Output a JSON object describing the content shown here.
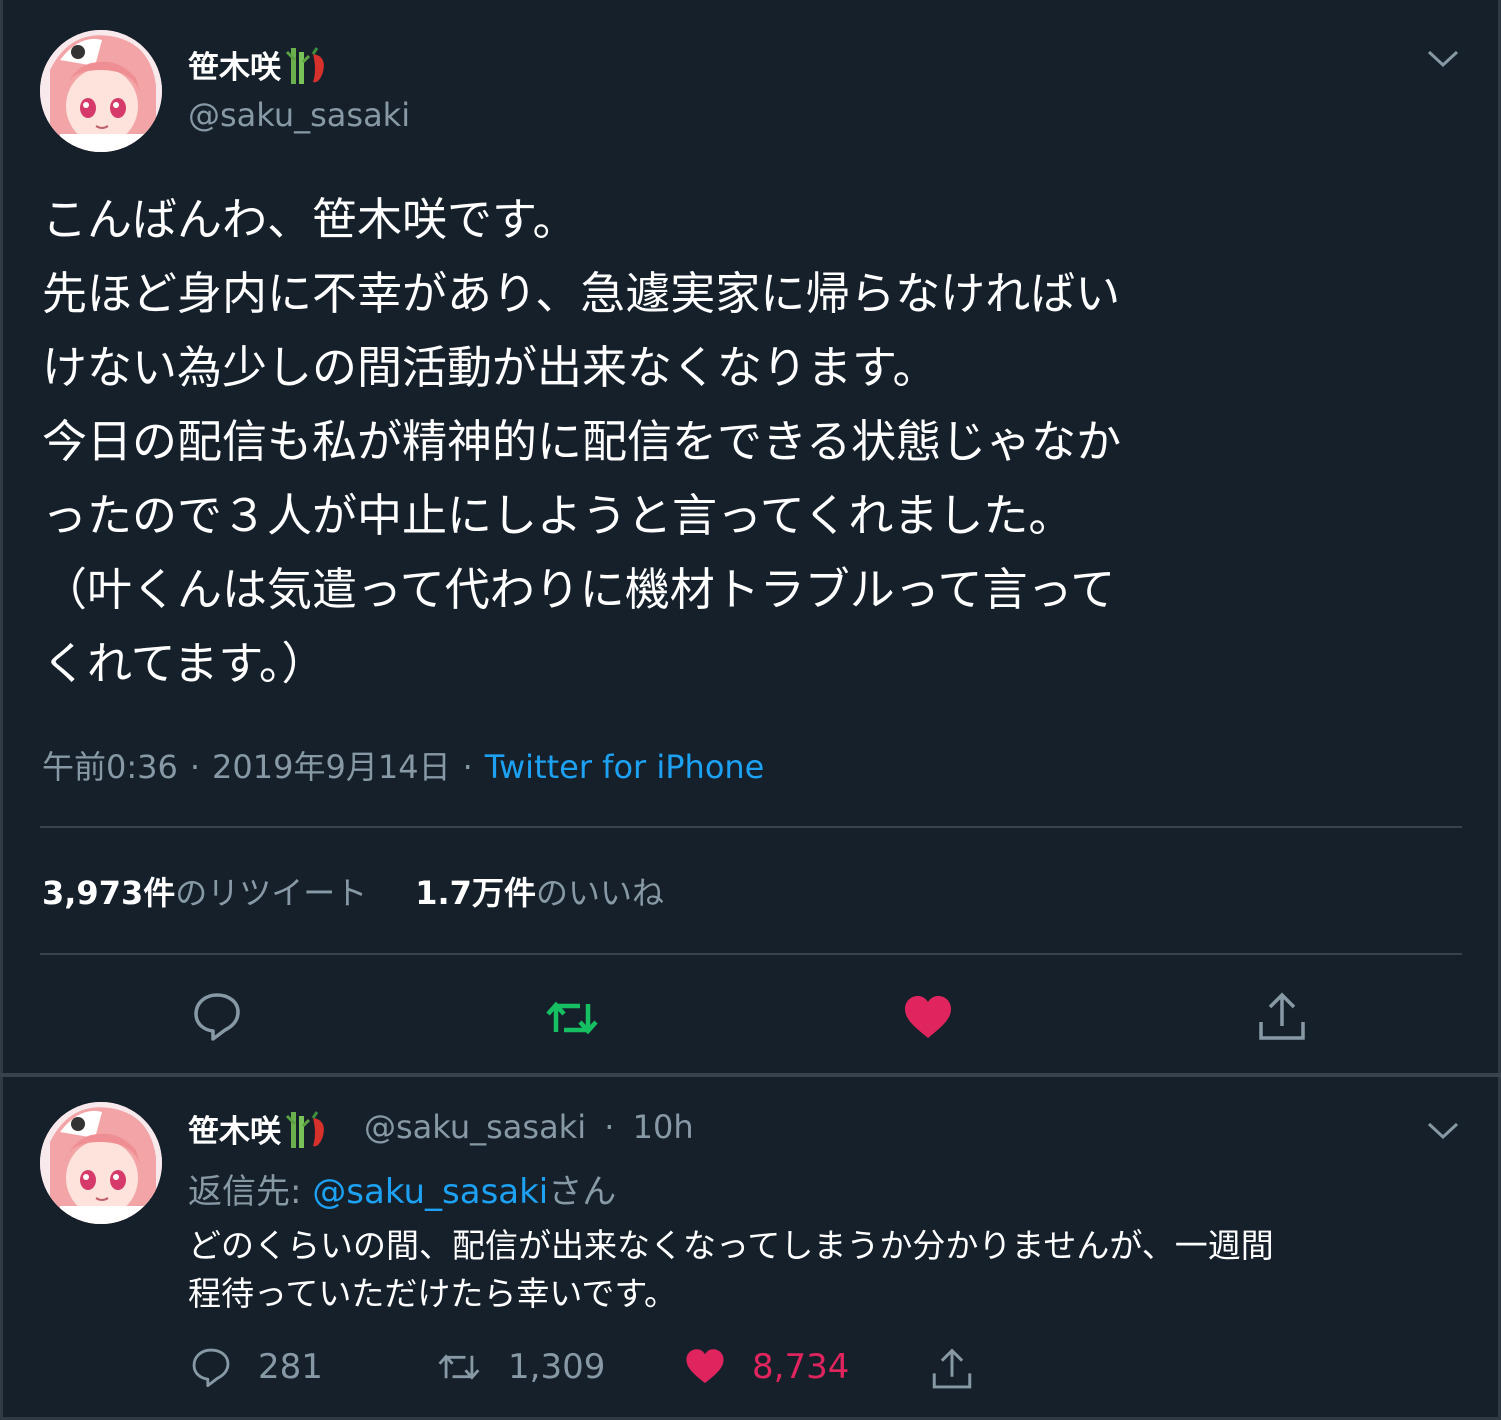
{
  "main_tweet": {
    "display_name": "笹木咲",
    "name_emoji": "bamboo-chili-emoji",
    "handle": "@saku_sasaki",
    "text_lines": [
      "こんばんわ、笹木咲です。",
      "先ほど身内に不幸があり、急遽実家に帰らなければい",
      "けない為少しの間活動が出来なくなります。",
      "今日の配信も私が精神的に配信をできる状態じゃなか",
      "ったので３人が中止にしようと言ってくれました。",
      "（叶くんは気遣って代わりに機材トラブルって言って",
      "くれてます。）"
    ],
    "time": "午前0:36",
    "date": "2019年9月14日",
    "source": "Twitter for iPhone",
    "retweet_count": "3,973件",
    "retweet_label": "のリツイート",
    "like_count": "1.7万件",
    "like_label": "のいいね",
    "actions": {
      "reply_icon": "reply-icon",
      "retweet_icon": "retweet-icon",
      "like_icon": "heart-icon",
      "share_icon": "share-icon",
      "retweet_color": "#17bf63",
      "like_color": "#e0245e"
    }
  },
  "reply_tweet": {
    "display_name": "笹木咲",
    "handle": "@saku_sasaki",
    "separator": "·",
    "time": "10h",
    "reply_to_label": "返信先:",
    "reply_to_handle": "@saku_sasaki",
    "reply_to_suffix": "さん",
    "text_lines": [
      "どのくらいの間、配信が出来なくなってしまうか分かりませんが、一週間",
      "程待っていただけたら幸いです。"
    ],
    "reply_count": "281",
    "retweet_count": "1,309",
    "like_count": "8,734"
  },
  "theme": {
    "background": "#15202b",
    "muted_text": "#8899a6",
    "link": "#1da1f2",
    "divider": "#38444d"
  }
}
